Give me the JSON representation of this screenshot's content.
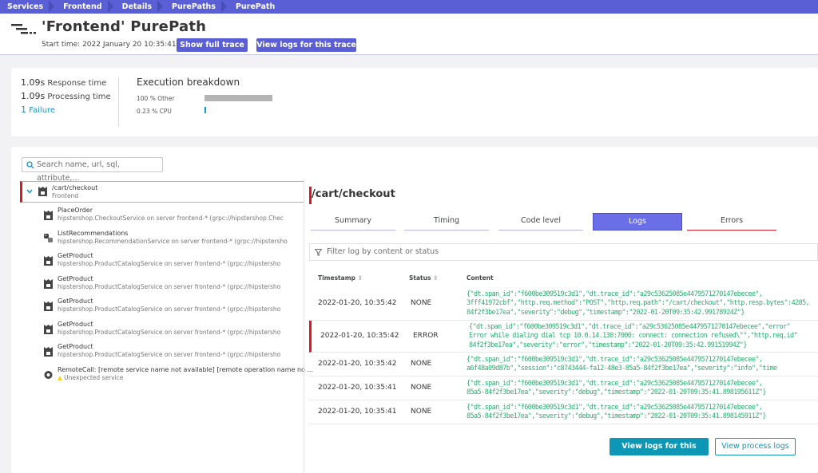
{
  "breadcrumb": [
    "Services",
    "Frontend",
    "Details",
    "PurePaths",
    "PurePath"
  ],
  "header": {
    "title": "'Frontend' PurePath",
    "start_time": "Start time: 2022 January 20 10:35:41",
    "show_full_trace": "Show full trace",
    "view_logs": "View logs for this trace"
  },
  "summary": {
    "response_value": "1.09s",
    "response_label": "Response time",
    "processing_value": "1.09s",
    "processing_label": "Processing time",
    "failure_count": "1",
    "failure_label": "Failure",
    "breakdown_title": "Execution breakdown",
    "breakdown": [
      {
        "label": "100 % Other",
        "value": 100,
        "color": "#b4b4b4"
      },
      {
        "label": "0.23 % CPU",
        "value": 0.23,
        "color": "#1496c8"
      }
    ]
  },
  "search": {
    "placeholder": "Search name, url, sql, attribute,..."
  },
  "tree": {
    "root": {
      "name": "/cart/checkout",
      "sub": "Frontend"
    },
    "items": [
      {
        "name": "PlaceOrder",
        "sub": "hipstershop.CheckoutService on server frontend-* (grpc://hipstershop.Chec",
        "icon": "service-icon"
      },
      {
        "name": "ListRecommendations",
        "sub": "hipstershop.RecommendationService on server frontend-* (grpc://hipstersho",
        "icon": "python-icon"
      },
      {
        "name": "GetProduct",
        "sub": "hipstershop.ProductCatalogService on server frontend-* (grpc://hipstersho",
        "icon": "service-icon"
      },
      {
        "name": "GetProduct",
        "sub": "hipstershop.ProductCatalogService on server frontend-* (grpc://hipstersho",
        "icon": "service-icon"
      },
      {
        "name": "GetProduct",
        "sub": "hipstershop.ProductCatalogService on server frontend-* (grpc://hipstersho",
        "icon": "service-icon"
      },
      {
        "name": "GetProduct",
        "sub": "hipstershop.ProductCatalogService on server frontend-* (grpc://hipstersho",
        "icon": "service-icon"
      },
      {
        "name": "GetProduct",
        "sub": "hipstershop.ProductCatalogService on server frontend-* (grpc://hipstersho",
        "icon": "service-icon"
      },
      {
        "name": "RemoteCall: [remote service name not available] [remote operation name no ...",
        "sub": "Unexpected service",
        "icon": "gear-icon"
      }
    ]
  },
  "detail": {
    "title": "/cart/checkout",
    "tabs": [
      "Summary",
      "Timing",
      "Code level",
      "Logs",
      "Errors"
    ],
    "filter_placeholder": "Filter log by content or status",
    "columns": [
      "Timestamp",
      "Status",
      "Content"
    ],
    "rows": [
      {
        "timestamp": "2022-01-20, 10:35:42",
        "status": "NONE",
        "content": [
          "{\"dt.span_id\":\"f600be309519c3d1\",\"dt.trace_id\":\"a29c53625085e4479571270147ebecee\",",
          "3fff41972cbf\",\"http.req.method\":\"POST\",\"http.req.path\":\"/cart/checkout\",\"http.resp.bytes\":4285,",
          "84f2f3be17ea\",\"severity\":\"debug\",\"timestamp\":\"2022-01-20T09:35:42.99178924Z\"}"
        ]
      },
      {
        "timestamp": "2022-01-20, 10:35:42",
        "status": "ERROR",
        "content": [
          "{\"dt.span_id\":\"f600be309519c3d1\",\"dt.trace_id\":\"a29c53625085e4479571270147ebecee\",\"error\"",
          "Error while dialing dial tcp 10.0.14.130:7000: connect: connection refused\\\"\",\"http.req.id\"",
          "84f2f3be17ea\",\"severity\":\"error\",\"timestamp\":\"2022-01-20T09:35:42.99151994Z\"}"
        ]
      },
      {
        "timestamp": "2022-01-20, 10:35:42",
        "status": "NONE",
        "content": [
          "{\"dt.span_id\":\"f600be309519c3d1\",\"dt.trace_id\":\"a29c53625085e4479571270147ebecee\",",
          "a6f48a09d87b\",\"session\":\"c8743444-fa12-48e3-85a5-84f2f3be17ea\",\"severity\":\"info\",\"time"
        ]
      },
      {
        "timestamp": "2022-01-20, 10:35:41",
        "status": "NONE",
        "content": [
          "{\"dt.span_id\":\"f600be309519c3d1\",\"dt.trace_id\":\"a29c53625085e4479571270147ebecee\",",
          "85a5-84f2f3be17ea\",\"severity\":\"debug\",\"timestamp\":\"2022-01-20T09:35:41.898195611Z\"}"
        ]
      },
      {
        "timestamp": "2022-01-20, 10:35:41",
        "status": "NONE",
        "content": [
          "{\"dt.span_id\":\"f600be309519c3d1\",\"dt.trace_id\":\"a29c53625085e4479571270147ebecee\",",
          "85a5-84f2f3be17ea\",\"severity\":\"debug\",\"timestamp\":\"2022-01-20T09:35:41.898145911Z\"}"
        ]
      }
    ],
    "view_logs_button": "View logs for this trace",
    "view_process_logs_button": "View process logs"
  }
}
